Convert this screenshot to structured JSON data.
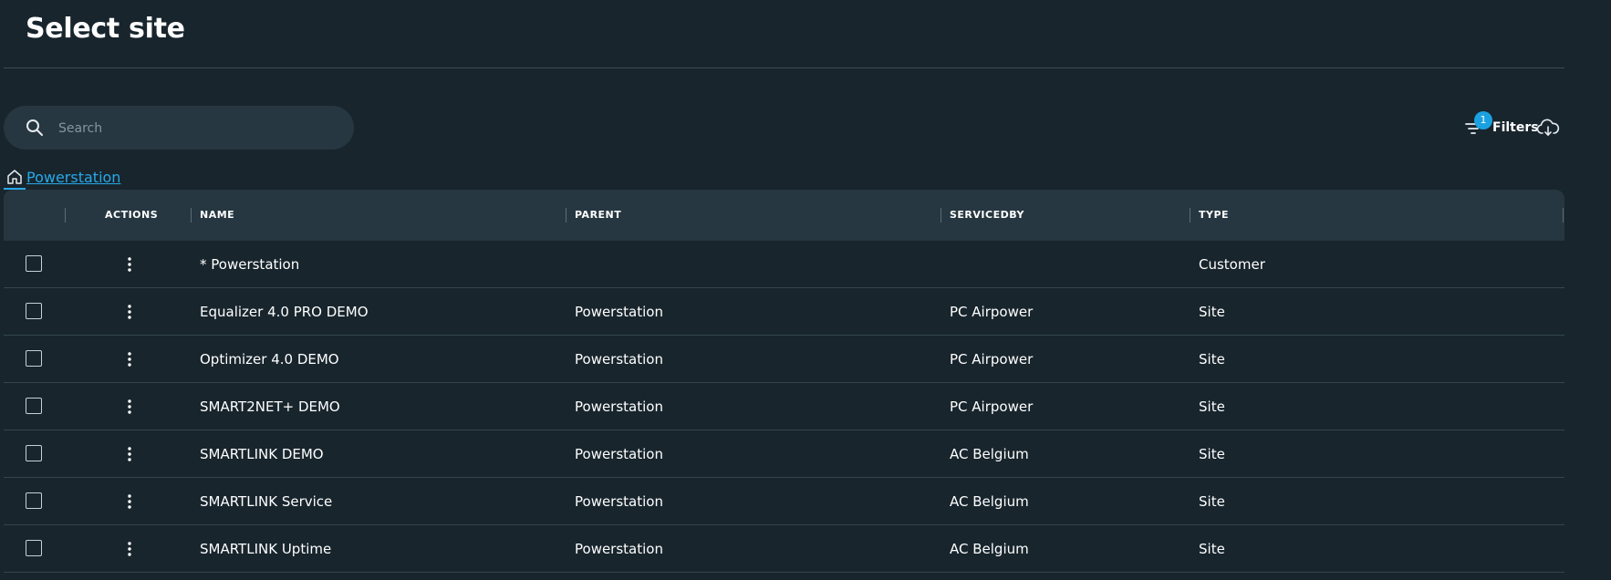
{
  "page": {
    "title": "Select site"
  },
  "search": {
    "placeholder": "Search",
    "value": ""
  },
  "toolbar": {
    "filters_label": "Filters",
    "filters_badge": "1",
    "filter_icon": "filter-icon",
    "export_icon": "cloud-download-icon"
  },
  "breadcrumb": {
    "home_icon": "home-icon",
    "label": "Powerstation"
  },
  "table": {
    "columns": {
      "actions": "ACTIONS",
      "name": "NAME",
      "parent": "PARENT",
      "servicedby": "SERVICEDBY",
      "type": "TYPE"
    },
    "rows": [
      {
        "name": "* Powerstation",
        "parent": "",
        "servicedby": "",
        "type": "Customer"
      },
      {
        "name": "Equalizer 4.0 PRO DEMO",
        "parent": "Powerstation",
        "servicedby": "PC Airpower",
        "type": "Site"
      },
      {
        "name": "Optimizer 4.0 DEMO",
        "parent": "Powerstation",
        "servicedby": "PC Airpower",
        "type": "Site"
      },
      {
        "name": "SMART2NET+ DEMO",
        "parent": "Powerstation",
        "servicedby": "PC Airpower",
        "type": "Site"
      },
      {
        "name": "SMARTLINK DEMO",
        "parent": "Powerstation",
        "servicedby": "AC Belgium",
        "type": "Site"
      },
      {
        "name": "SMARTLINK Service",
        "parent": "Powerstation",
        "servicedby": "AC Belgium",
        "type": "Site"
      },
      {
        "name": "SMARTLINK Uptime",
        "parent": "Powerstation",
        "servicedby": "AC Belgium",
        "type": "Site"
      }
    ]
  },
  "colors": {
    "background": "#18252d",
    "surface": "#263741",
    "accent": "#27a9e8",
    "badge": "#1ba1e2"
  }
}
